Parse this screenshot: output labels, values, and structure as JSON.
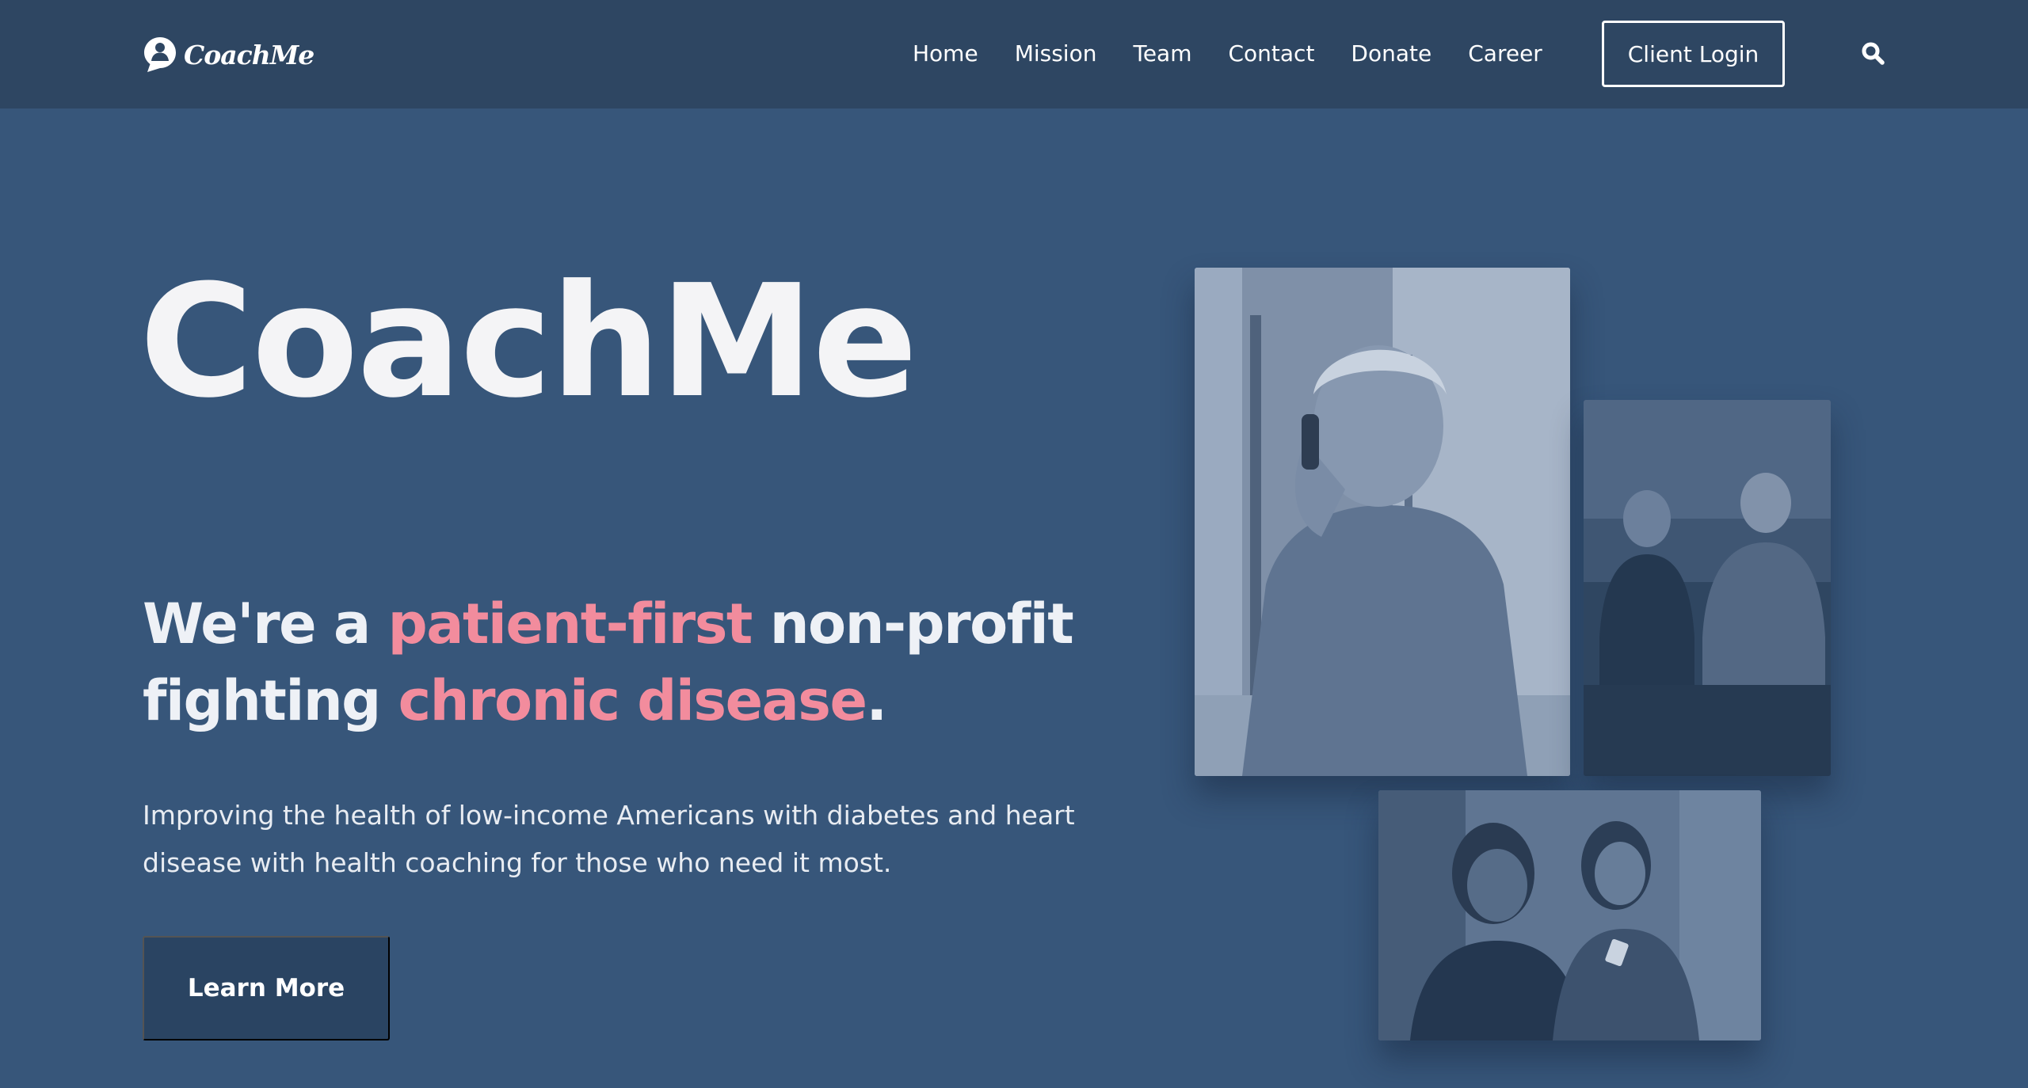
{
  "header": {
    "logo_text": "CoachMe",
    "nav": [
      {
        "label": "Home"
      },
      {
        "label": "Mission"
      },
      {
        "label": "Team"
      },
      {
        "label": "Contact"
      },
      {
        "label": "Donate"
      },
      {
        "label": "Career"
      }
    ],
    "login_label": "Client Login",
    "search_icon": "search-icon"
  },
  "hero": {
    "title": "CoachMe",
    "tagline": {
      "part1": "We're a ",
      "highlight1": "patient-first",
      "part2": " non-profit fighting ",
      "highlight2": "chronic disease",
      "part3": "."
    },
    "description": "Improving the health of low-income Americans with diabetes and heart disease with health coaching for those who need it most.",
    "cta_label": "Learn More"
  },
  "photos": [
    {
      "subject": "elderly woman smiling on phone"
    },
    {
      "subject": "two people seated together"
    },
    {
      "subject": "two women reviewing a card"
    }
  ],
  "colors": {
    "page_background": "#37567a",
    "header_background": "#2e4662",
    "accent_pink": "#f28c9d",
    "button_background": "#2a4462"
  }
}
